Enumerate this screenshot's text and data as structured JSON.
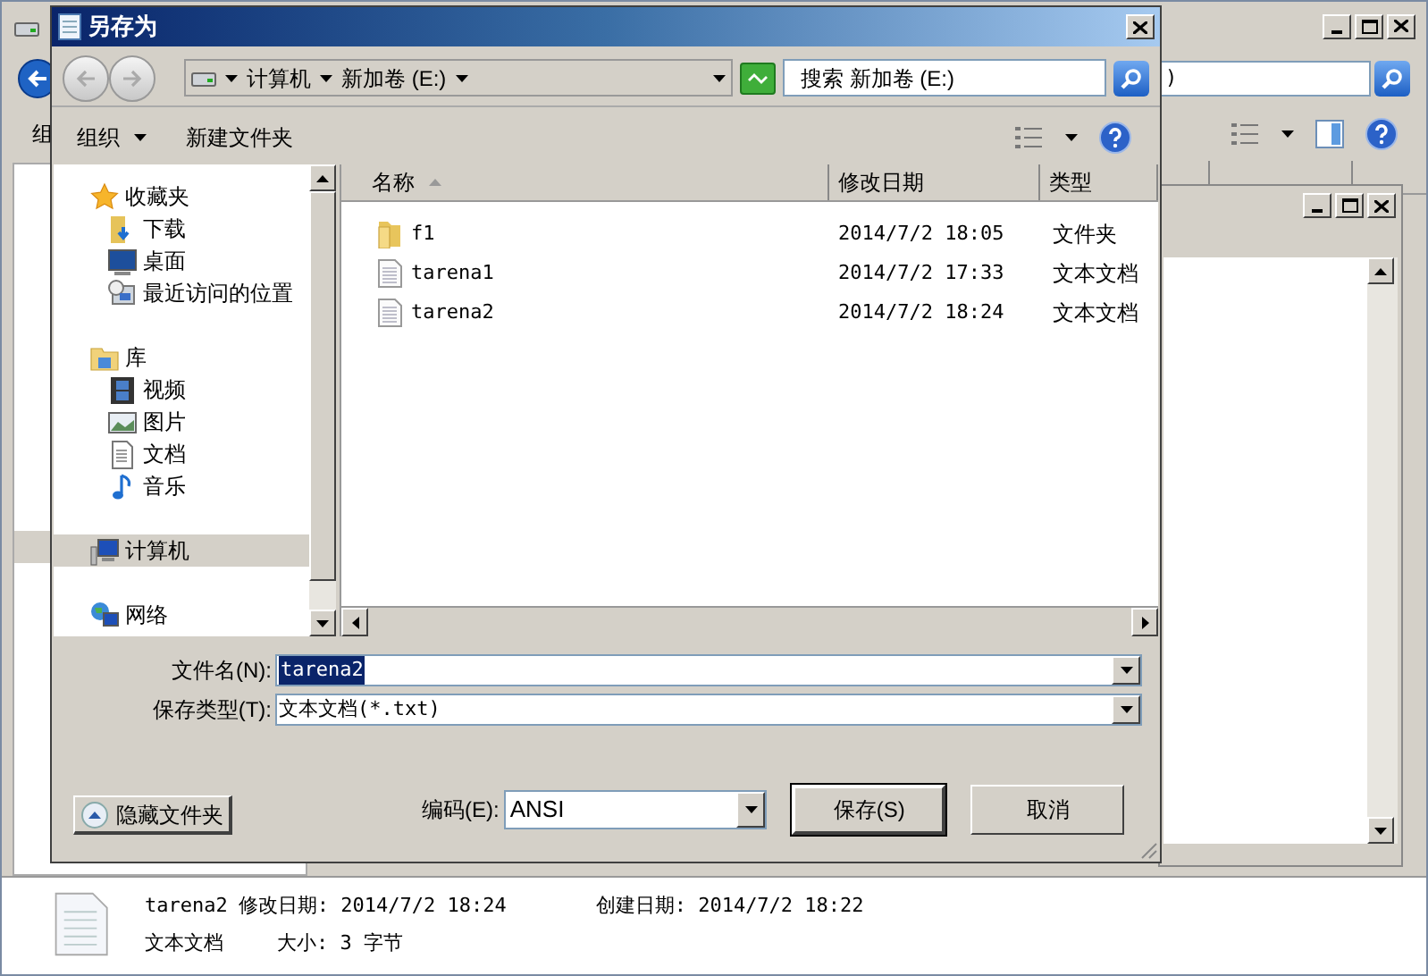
{
  "background_window": {
    "toolbar_label": "组",
    "search_value": ")",
    "details": {
      "file_name": "tarena2",
      "modified": "修改日期: 2014/7/2 18:24",
      "created": "创建日期: 2014/7/2 18:22",
      "type": "文本文档",
      "size": "大小: 3 字节"
    }
  },
  "dialog": {
    "title": "另存为",
    "breadcrumb": [
      "计算机",
      "新加卷 (E:)"
    ],
    "search": {
      "placeholder": "搜索 新加卷 (E:)"
    },
    "toolbar": [
      {
        "label": "组织",
        "dropdown": true
      },
      {
        "label": "新建文件夹",
        "dropdown": false
      }
    ],
    "nav_pane": [
      {
        "label": "收藏夹",
        "kind": "star",
        "selected": false,
        "children": [
          {
            "label": "下载",
            "kind": "download",
            "selected": false
          },
          {
            "label": "桌面",
            "kind": "desktop",
            "selected": false
          },
          {
            "label": "最近访问的位置",
            "kind": "recent",
            "selected": false
          }
        ]
      },
      {
        "label": "库",
        "kind": "library",
        "selected": false,
        "children": [
          {
            "label": "视频",
            "kind": "video",
            "selected": false
          },
          {
            "label": "图片",
            "kind": "picture",
            "selected": false
          },
          {
            "label": "文档",
            "kind": "document",
            "selected": false
          },
          {
            "label": "音乐",
            "kind": "music",
            "selected": false
          }
        ]
      },
      {
        "label": "计算机",
        "kind": "computer",
        "selected": true
      },
      {
        "label": "网络",
        "kind": "network",
        "selected": false
      }
    ],
    "columns": [
      {
        "label": "名称",
        "sorted": true
      },
      {
        "label": "修改日期",
        "sorted": false
      },
      {
        "label": "类型",
        "sorted": false
      }
    ],
    "files": [
      {
        "kind": "folder",
        "name": "f1",
        "modified": "2014/7/2 18:05",
        "type": "文件夹"
      },
      {
        "kind": "text",
        "name": "tarena1",
        "modified": "2014/7/2 17:33",
        "type": "文本文档"
      },
      {
        "kind": "text",
        "name": "tarena2",
        "modified": "2014/7/2 18:24",
        "type": "文本文档"
      }
    ],
    "file_name": {
      "label": "文件名(N):",
      "value": "tarena2",
      "value_selected": true
    },
    "save_type": {
      "label": "保存类型(T):",
      "value": "文本文档(*.txt)"
    },
    "hide_folders": "隐藏文件夹",
    "encoding": {
      "label": "编码(E):",
      "value": "ANSI"
    },
    "buttons": [
      {
        "label": "保存(S)",
        "default": true
      },
      {
        "label": "取消",
        "default": false
      }
    ]
  }
}
